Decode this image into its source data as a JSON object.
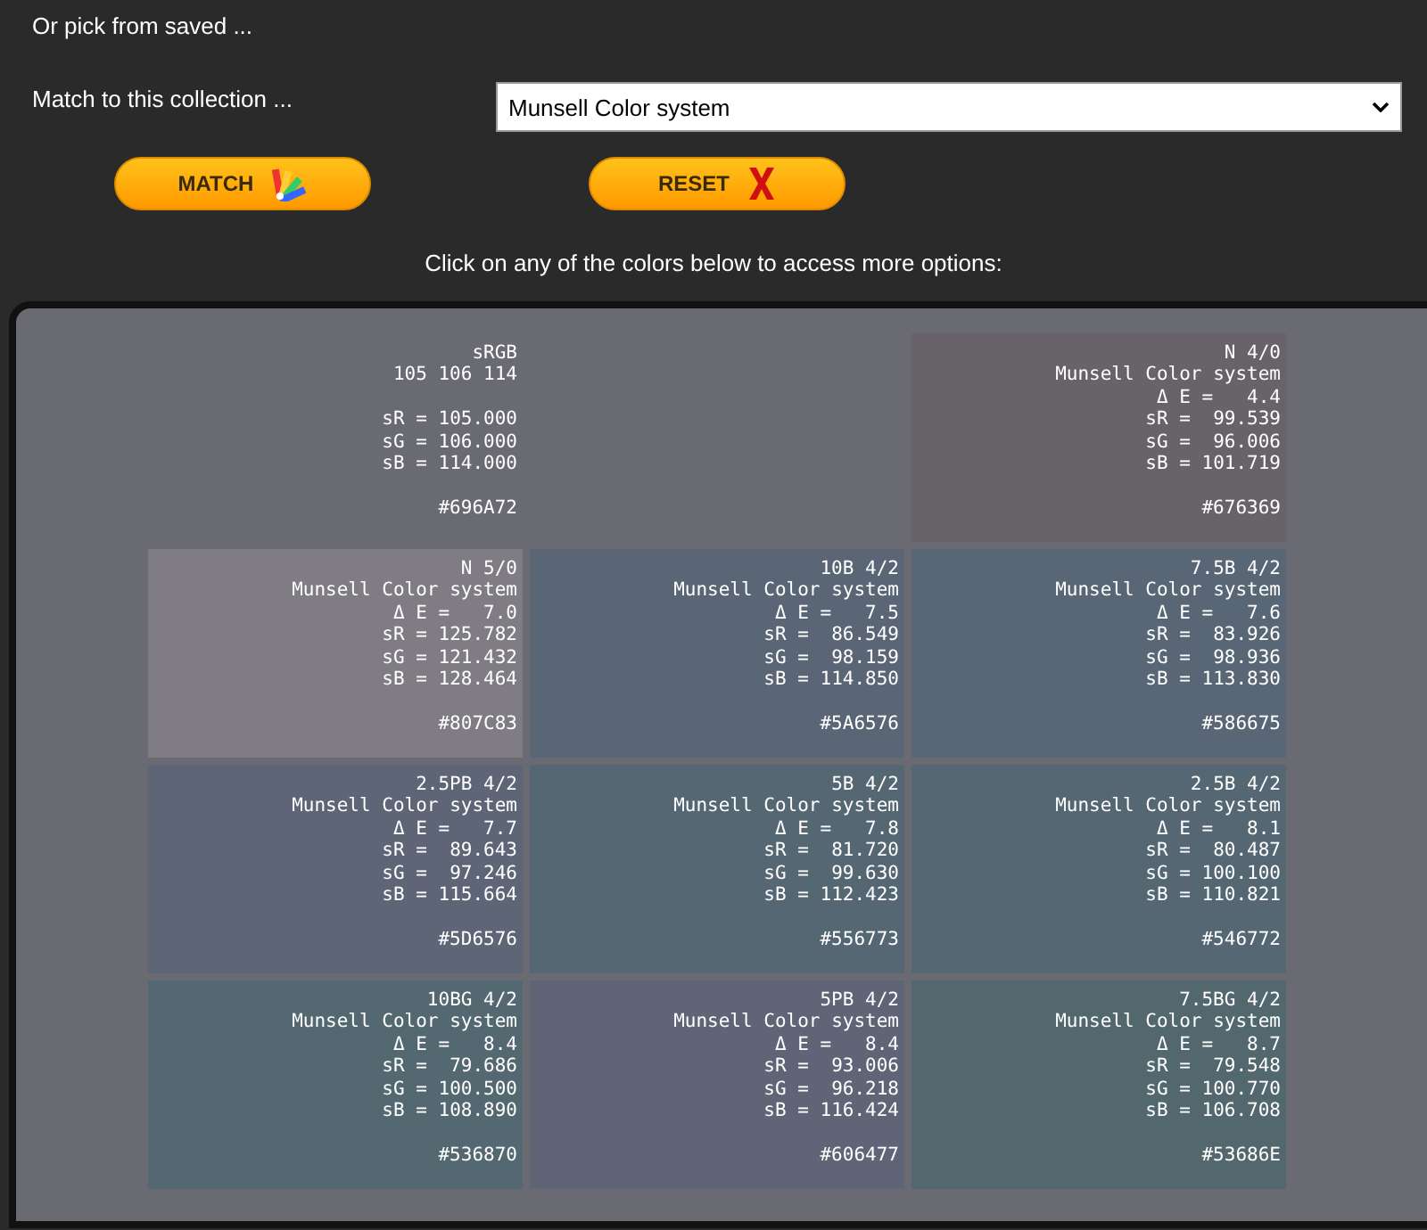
{
  "pick_saved_label": "Or pick from saved ...",
  "collection_label": "Match to this collection ...",
  "collection_select": {
    "value": "Munsell Color system"
  },
  "buttons": [
    {
      "kind": "match",
      "label": "MATCH"
    },
    {
      "kind": "reset",
      "label": "RESET"
    }
  ],
  "instructions": "Click on any of the colors below to access more options:",
  "source": {
    "title": "sRGB",
    "values": "105 106 114",
    "sR": "sR = 105.000",
    "sG": "sG = 106.000",
    "sB": "sB = 114.000",
    "hex": "#696A72",
    "color": "#696a72"
  },
  "matches": [
    {
      "name": "N 4/0",
      "collection": "Munsell Color system",
      "delta_e": "Δ E =   4.4",
      "sR": "sR =  99.539",
      "sG": "sG =  96.006",
      "sB": "sB = 101.719",
      "hex": "#676369",
      "color": "#676369"
    },
    {
      "name": "N 5/0",
      "collection": "Munsell Color system",
      "delta_e": "Δ E =   7.0",
      "sR": "sR = 125.782",
      "sG": "sG = 121.432",
      "sB": "sB = 128.464",
      "hex": "#807C83",
      "color": "#807c83"
    },
    {
      "name": "10B 4/2",
      "collection": "Munsell Color system",
      "delta_e": "Δ E =   7.5",
      "sR": "sR =  86.549",
      "sG": "sG =  98.159",
      "sB": "sB = 114.850",
      "hex": "#5A6576",
      "color": "#5a6576"
    },
    {
      "name": "7.5B 4/2",
      "collection": "Munsell Color system",
      "delta_e": "Δ E =   7.6",
      "sR": "sR =  83.926",
      "sG": "sG =  98.936",
      "sB": "sB = 113.830",
      "hex": "#586675",
      "color": "#586675"
    },
    {
      "name": "2.5PB 4/2",
      "collection": "Munsell Color system",
      "delta_e": "Δ E =   7.7",
      "sR": "sR =  89.643",
      "sG": "sG =  97.246",
      "sB": "sB = 115.664",
      "hex": "#5D6576",
      "color": "#5d6576"
    },
    {
      "name": "5B 4/2",
      "collection": "Munsell Color system",
      "delta_e": "Δ E =   7.8",
      "sR": "sR =  81.720",
      "sG": "sG =  99.630",
      "sB": "sB = 112.423",
      "hex": "#556773",
      "color": "#556773"
    },
    {
      "name": "2.5B 4/2",
      "collection": "Munsell Color system",
      "delta_e": "Δ E =   8.1",
      "sR": "sR =  80.487",
      "sG": "sG = 100.100",
      "sB": "sB = 110.821",
      "hex": "#546772",
      "color": "#546772"
    },
    {
      "name": "10BG 4/2",
      "collection": "Munsell Color system",
      "delta_e": "Δ E =   8.4",
      "sR": "sR =  79.686",
      "sG": "sG = 100.500",
      "sB": "sB = 108.890",
      "hex": "#536870",
      "color": "#536870"
    },
    {
      "name": "5PB 4/2",
      "collection": "Munsell Color system",
      "delta_e": "Δ E =   8.4",
      "sR": "sR =  93.006",
      "sG": "sG =  96.218",
      "sB": "sB = 116.424",
      "hex": "#606477",
      "color": "#606477"
    },
    {
      "name": "7.5BG 4/2",
      "collection": "Munsell Color system",
      "delta_e": "Δ E =   8.7",
      "sR": "sR =  79.548",
      "sG": "sG = 100.770",
      "sB": "sB = 106.708",
      "hex": "#53686E",
      "color": "#53686e"
    }
  ]
}
